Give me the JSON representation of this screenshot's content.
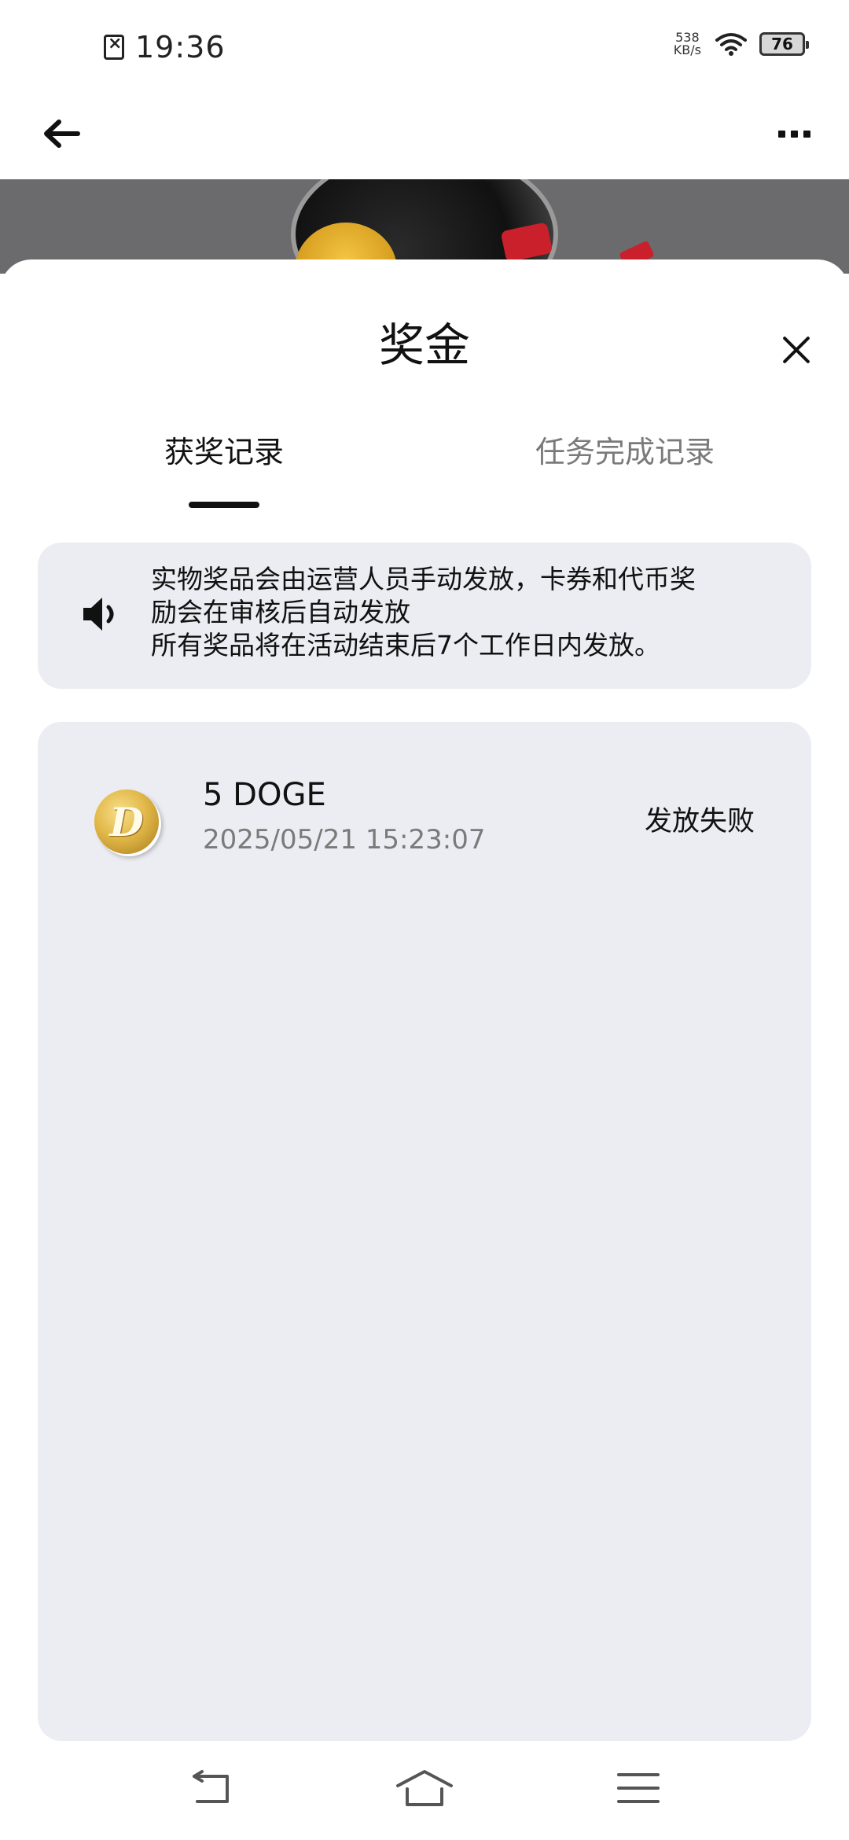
{
  "status_bar": {
    "time": "19:36",
    "net_speed_value": "538",
    "net_speed_unit": "KB/s",
    "battery_level": "76"
  },
  "sheet": {
    "title": "奖金",
    "tabs": [
      {
        "label": "获奖记录",
        "active": true
      },
      {
        "label": "任务完成记录",
        "active": false
      }
    ],
    "notice": {
      "lines": [
        "实物奖品会由运营人员手动发放，卡券和代币奖",
        "励会在审核后自动发放",
        "所有奖品将在活动结束后7个工作日内发放。"
      ]
    },
    "records": [
      {
        "coin_glyph": "D",
        "amount": "5 DOGE",
        "time": "2025/05/21 15:23:07",
        "status": "发放失败"
      }
    ]
  }
}
